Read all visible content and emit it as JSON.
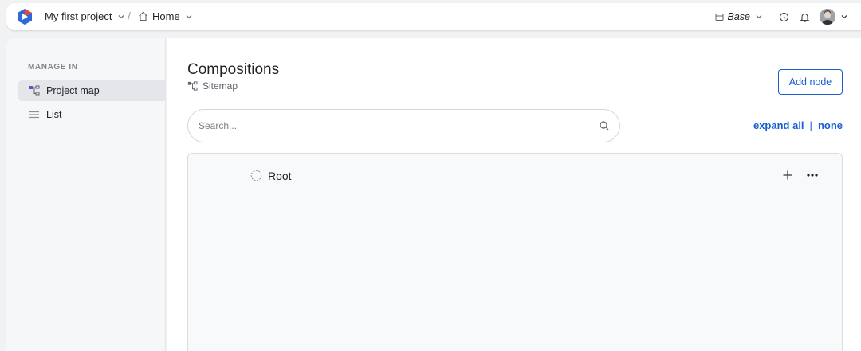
{
  "topbar": {
    "project_name": "My first project",
    "separator": "/",
    "home_label": "Home",
    "environment": "Base"
  },
  "sidebar": {
    "heading": "MANAGE IN",
    "items": [
      {
        "label": "Project map",
        "icon": "sitemap-icon",
        "active": true
      },
      {
        "label": "List",
        "icon": "list-icon",
        "active": false
      }
    ]
  },
  "main": {
    "title": "Compositions",
    "subtitle": "Sitemap",
    "add_node_label": "Add node",
    "search": {
      "placeholder": "Search...",
      "value": ""
    },
    "expand_all_label": "expand all",
    "divider": "|",
    "none_label": "none",
    "tree": {
      "root_label": "Root"
    }
  },
  "colors": {
    "accent": "#1a5fcf",
    "sidebar_bg": "#f6f7f8",
    "active_item_bg": "#e4e6e9",
    "tree_bg": "#f8f9fa"
  }
}
